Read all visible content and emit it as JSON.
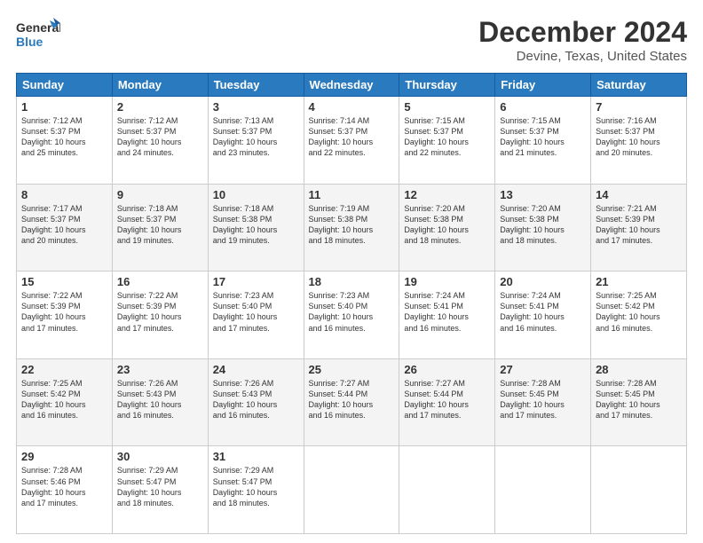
{
  "logo": {
    "line1": "General",
    "line2": "Blue"
  },
  "title": "December 2024",
  "location": "Devine, Texas, United States",
  "days_of_week": [
    "Sunday",
    "Monday",
    "Tuesday",
    "Wednesday",
    "Thursday",
    "Friday",
    "Saturday"
  ],
  "weeks": [
    [
      {
        "day": "1",
        "info": "Sunrise: 7:12 AM\nSunset: 5:37 PM\nDaylight: 10 hours\nand 25 minutes."
      },
      {
        "day": "2",
        "info": "Sunrise: 7:12 AM\nSunset: 5:37 PM\nDaylight: 10 hours\nand 24 minutes."
      },
      {
        "day": "3",
        "info": "Sunrise: 7:13 AM\nSunset: 5:37 PM\nDaylight: 10 hours\nand 23 minutes."
      },
      {
        "day": "4",
        "info": "Sunrise: 7:14 AM\nSunset: 5:37 PM\nDaylight: 10 hours\nand 22 minutes."
      },
      {
        "day": "5",
        "info": "Sunrise: 7:15 AM\nSunset: 5:37 PM\nDaylight: 10 hours\nand 22 minutes."
      },
      {
        "day": "6",
        "info": "Sunrise: 7:15 AM\nSunset: 5:37 PM\nDaylight: 10 hours\nand 21 minutes."
      },
      {
        "day": "7",
        "info": "Sunrise: 7:16 AM\nSunset: 5:37 PM\nDaylight: 10 hours\nand 20 minutes."
      }
    ],
    [
      {
        "day": "8",
        "info": "Sunrise: 7:17 AM\nSunset: 5:37 PM\nDaylight: 10 hours\nand 20 minutes."
      },
      {
        "day": "9",
        "info": "Sunrise: 7:18 AM\nSunset: 5:37 PM\nDaylight: 10 hours\nand 19 minutes."
      },
      {
        "day": "10",
        "info": "Sunrise: 7:18 AM\nSunset: 5:38 PM\nDaylight: 10 hours\nand 19 minutes."
      },
      {
        "day": "11",
        "info": "Sunrise: 7:19 AM\nSunset: 5:38 PM\nDaylight: 10 hours\nand 18 minutes."
      },
      {
        "day": "12",
        "info": "Sunrise: 7:20 AM\nSunset: 5:38 PM\nDaylight: 10 hours\nand 18 minutes."
      },
      {
        "day": "13",
        "info": "Sunrise: 7:20 AM\nSunset: 5:38 PM\nDaylight: 10 hours\nand 18 minutes."
      },
      {
        "day": "14",
        "info": "Sunrise: 7:21 AM\nSunset: 5:39 PM\nDaylight: 10 hours\nand 17 minutes."
      }
    ],
    [
      {
        "day": "15",
        "info": "Sunrise: 7:22 AM\nSunset: 5:39 PM\nDaylight: 10 hours\nand 17 minutes."
      },
      {
        "day": "16",
        "info": "Sunrise: 7:22 AM\nSunset: 5:39 PM\nDaylight: 10 hours\nand 17 minutes."
      },
      {
        "day": "17",
        "info": "Sunrise: 7:23 AM\nSunset: 5:40 PM\nDaylight: 10 hours\nand 17 minutes."
      },
      {
        "day": "18",
        "info": "Sunrise: 7:23 AM\nSunset: 5:40 PM\nDaylight: 10 hours\nand 16 minutes."
      },
      {
        "day": "19",
        "info": "Sunrise: 7:24 AM\nSunset: 5:41 PM\nDaylight: 10 hours\nand 16 minutes."
      },
      {
        "day": "20",
        "info": "Sunrise: 7:24 AM\nSunset: 5:41 PM\nDaylight: 10 hours\nand 16 minutes."
      },
      {
        "day": "21",
        "info": "Sunrise: 7:25 AM\nSunset: 5:42 PM\nDaylight: 10 hours\nand 16 minutes."
      }
    ],
    [
      {
        "day": "22",
        "info": "Sunrise: 7:25 AM\nSunset: 5:42 PM\nDaylight: 10 hours\nand 16 minutes."
      },
      {
        "day": "23",
        "info": "Sunrise: 7:26 AM\nSunset: 5:43 PM\nDaylight: 10 hours\nand 16 minutes."
      },
      {
        "day": "24",
        "info": "Sunrise: 7:26 AM\nSunset: 5:43 PM\nDaylight: 10 hours\nand 16 minutes."
      },
      {
        "day": "25",
        "info": "Sunrise: 7:27 AM\nSunset: 5:44 PM\nDaylight: 10 hours\nand 16 minutes."
      },
      {
        "day": "26",
        "info": "Sunrise: 7:27 AM\nSunset: 5:44 PM\nDaylight: 10 hours\nand 17 minutes."
      },
      {
        "day": "27",
        "info": "Sunrise: 7:28 AM\nSunset: 5:45 PM\nDaylight: 10 hours\nand 17 minutes."
      },
      {
        "day": "28",
        "info": "Sunrise: 7:28 AM\nSunset: 5:45 PM\nDaylight: 10 hours\nand 17 minutes."
      }
    ],
    [
      {
        "day": "29",
        "info": "Sunrise: 7:28 AM\nSunset: 5:46 PM\nDaylight: 10 hours\nand 17 minutes."
      },
      {
        "day": "30",
        "info": "Sunrise: 7:29 AM\nSunset: 5:47 PM\nDaylight: 10 hours\nand 18 minutes."
      },
      {
        "day": "31",
        "info": "Sunrise: 7:29 AM\nSunset: 5:47 PM\nDaylight: 10 hours\nand 18 minutes."
      },
      {
        "day": "",
        "info": ""
      },
      {
        "day": "",
        "info": ""
      },
      {
        "day": "",
        "info": ""
      },
      {
        "day": "",
        "info": ""
      }
    ]
  ]
}
